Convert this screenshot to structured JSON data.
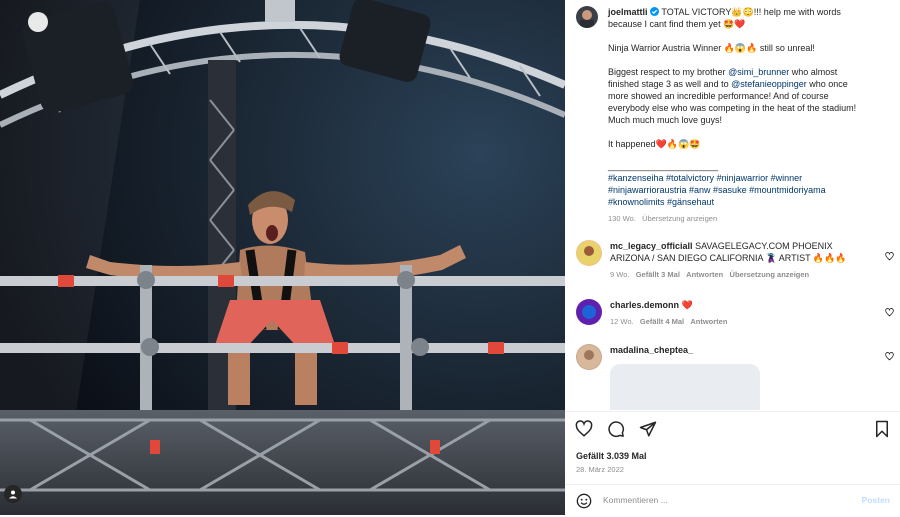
{
  "post": {
    "username": "joelmattli",
    "caption_lines": [
      "TOTAL VICTORY👑😳!!! help me with words because I cant find them yet 🤩❤️",
      "Ninja Warrior Austria Winner 🔥😱🔥 still so unreal!"
    ],
    "para2_a": "Biggest respect to my brother ",
    "para2_link1": "@simi_brunner",
    "para2_b": " who almost finished stage 3 as well and to ",
    "para2_link2": "@stefanieoppinger",
    "para2_c": " who once more showed an incredible performance! And of course everybody else who was competing in the heat of the stadium! Much much much love guys!",
    "para3": "It happened❤️🔥😱🤩",
    "divider": "______________________",
    "hashtags": "#kanzenseiha #totalvictory #ninjawarrior #winner #ninjawarrioraustria #anw #sasuke #mountmidoriyama #knownolimits #gänsehaut",
    "age": "130 Wo.",
    "translate": "Übersetzung anzeigen"
  },
  "comments": [
    {
      "username": "mc_legacy_officiall",
      "text": "SAVAGELEGACY.COM PHOENIX ARIZONA / SAN DIEGO CALIFORNIA 🦹‍♂️ ARTIST 🔥🔥🔥",
      "age": "9 Wo.",
      "likes": "Gefällt 3 Mal",
      "reply": "Antworten",
      "translate": "Übersetzung anzeigen"
    },
    {
      "username": "charles.demonn",
      "text": "❤️",
      "age": "12 Wo.",
      "likes": "Gefällt 4 Mal",
      "reply": "Antworten"
    },
    {
      "username": "madalina_cheptea_",
      "text": ""
    }
  ],
  "likes_text": "Gefällt 3.039 Mal",
  "date_text": "28. März 2022",
  "comment_placeholder": "Kommentieren ...",
  "post_label": "Posten",
  "icons": [
    "heart-icon",
    "comment-icon",
    "share-icon",
    "bookmark-icon",
    "emoji-icon",
    "user-tag-icon",
    "verified-badge-icon"
  ],
  "colors": {
    "link": "#00376b",
    "muted": "#8e8e8e",
    "verified": "#0095f6",
    "post_button": "#c0dffd"
  }
}
